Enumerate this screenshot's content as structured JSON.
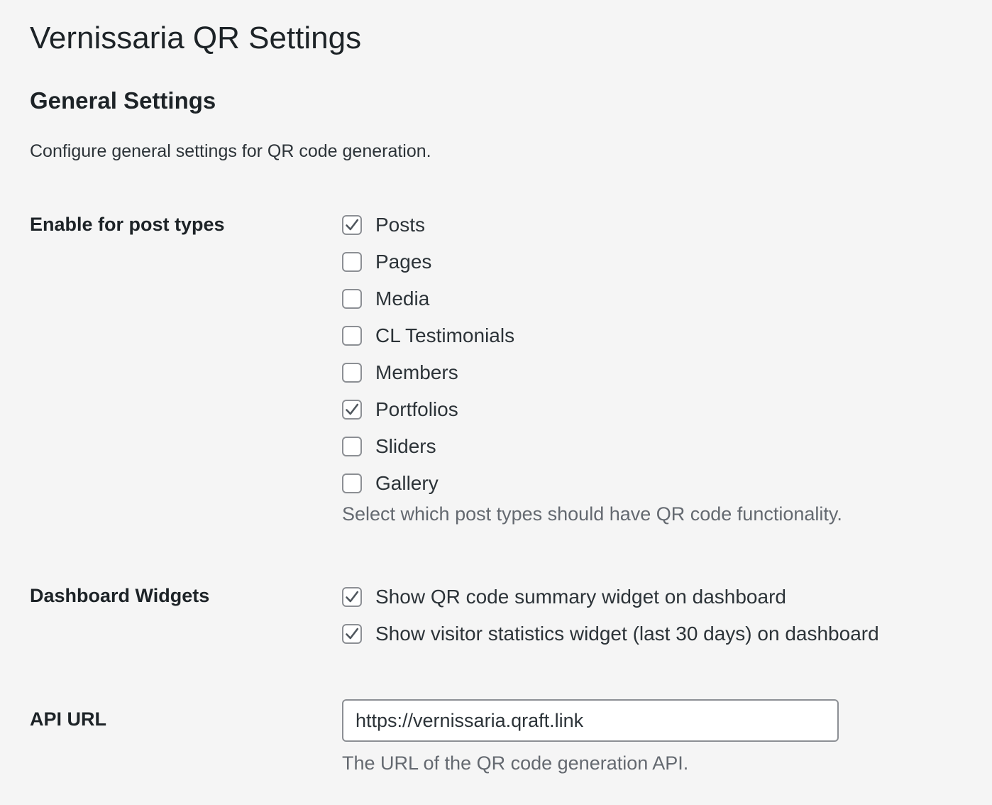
{
  "page": {
    "title": "Vernissaria QR Settings"
  },
  "section": {
    "title": "General Settings",
    "description": "Configure general settings for QR code generation."
  },
  "post_types": {
    "label": "Enable for post types",
    "options": [
      {
        "label": "Posts",
        "checked": true
      },
      {
        "label": "Pages",
        "checked": false
      },
      {
        "label": "Media",
        "checked": false
      },
      {
        "label": "CL Testimonials",
        "checked": false
      },
      {
        "label": "Members",
        "checked": false
      },
      {
        "label": "Portfolios",
        "checked": true
      },
      {
        "label": "Sliders",
        "checked": false
      },
      {
        "label": "Gallery",
        "checked": false
      }
    ],
    "description": "Select which post types should have QR code functionality."
  },
  "dashboard_widgets": {
    "label": "Dashboard Widgets",
    "options": [
      {
        "label": "Show QR code summary widget on dashboard",
        "checked": true
      },
      {
        "label": "Show visitor statistics widget (last 30 days) on dashboard",
        "checked": true
      }
    ]
  },
  "api_url": {
    "label": "API URL",
    "value": "https://vernissaria.qraft.link",
    "description": "The URL of the QR code generation API."
  }
}
